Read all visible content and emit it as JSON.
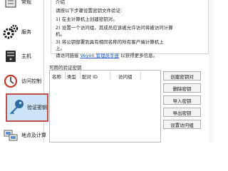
{
  "sidebar": {
    "items": [
      {
        "label": "常规",
        "icon": "general-icon"
      },
      {
        "label": "服务",
        "icon": "gears-icon"
      },
      {
        "label": "主机",
        "icon": "host-icon"
      },
      {
        "label": "访问控制",
        "icon": "access-control-icon"
      },
      {
        "label": "验证密钥",
        "icon": "key-icon",
        "active": true
      },
      {
        "label": "地点及计算",
        "icon": "location-icon"
      }
    ]
  },
  "description": {
    "title": "介绍",
    "line1": "请按以下步骤设置密钥文件验证:",
    "line2": "1) 在主计算机上创建密钥对。",
    "line3": "2) 设置一个访问组，其成员应该被允许访问将被访问计算",
    "line4": "机。",
    "line5": "3) 将公钥部署到具有相同名称的所有客户端计算机上",
    "line6": "上。",
    "line7_prefix": "请访问链接",
    "link_text": "Veyon 管理员手册",
    "line7_suffix": "以获得更多信息。"
  },
  "keys": {
    "group_label": "可用的验证密钥",
    "columns": [
      "名称",
      "类型",
      "配对 ID",
      "访问组"
    ],
    "rows": []
  },
  "buttons": {
    "create": "创建密钥对",
    "delete": "删除密钥",
    "import": "导入密钥",
    "export": "导出密钥",
    "set_group": "设置访问组"
  },
  "colors": {
    "active_bg": "#cde3f7",
    "active_border": "#c0504d",
    "link": "#1a56c5"
  }
}
